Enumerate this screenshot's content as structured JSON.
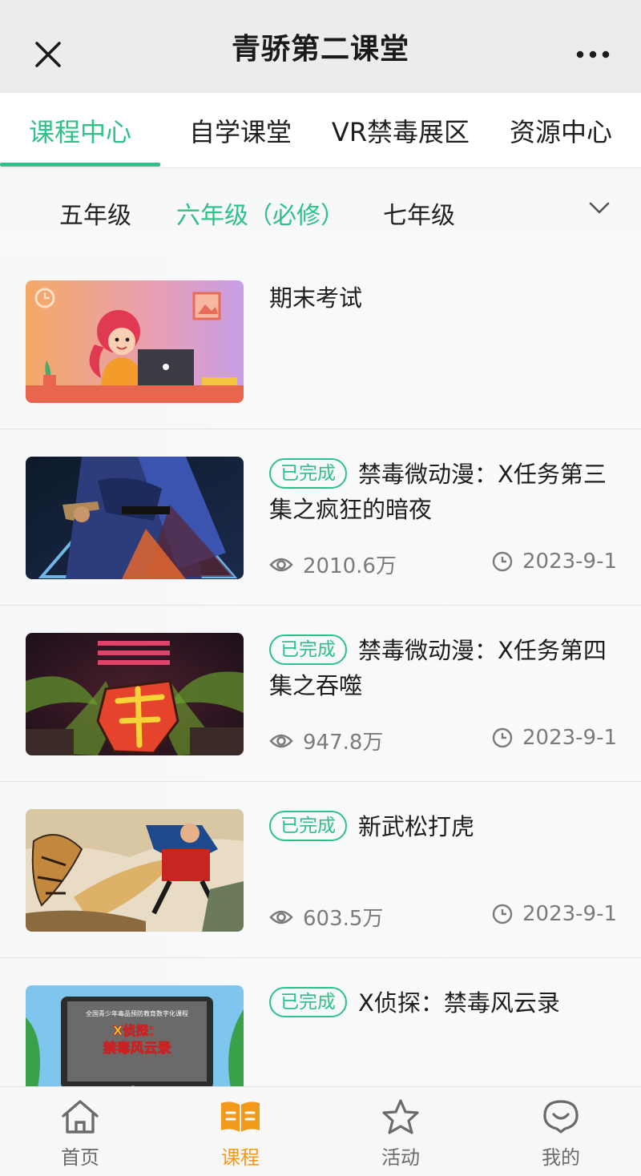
{
  "nav": {
    "title": "青骄第二课堂"
  },
  "tabs": [
    {
      "label": "课程中心",
      "active": true
    },
    {
      "label": "自学课堂",
      "active": false
    },
    {
      "label": "VR禁毒展区",
      "active": false
    },
    {
      "label": "资源中心",
      "active": false
    }
  ],
  "grades": [
    {
      "label": "五年级",
      "active": false
    },
    {
      "label": "六年级（必修）",
      "active": true
    },
    {
      "label": "七年级",
      "active": false
    }
  ],
  "courses": [
    {
      "badge": "",
      "title": "期末考试",
      "views": "",
      "date": ""
    },
    {
      "badge": "已完成",
      "title": "禁毒微动漫：X任务第三集之疯狂的暗夜",
      "views": "2010.6万",
      "date": "2023-9-1"
    },
    {
      "badge": "已完成",
      "title": "禁毒微动漫：X任务第四集之吞噬",
      "views": "947.8万",
      "date": "2023-9-1"
    },
    {
      "badge": "已完成",
      "title": "新武松打虎",
      "views": "603.5万",
      "date": "2023-9-1"
    },
    {
      "badge": "已完成",
      "title": "X侦探：禁毒风云录",
      "views": "",
      "date": ""
    }
  ],
  "thumb_texts": {
    "course4_line1": "全国青少年毒品预防教育数字化课程",
    "course4_line2": "X侦探：",
    "course4_line3": "禁毒风云录"
  },
  "bottom_nav": [
    {
      "label": "首页",
      "icon": "home-icon",
      "active": false
    },
    {
      "label": "课程",
      "icon": "book-icon",
      "active": true
    },
    {
      "label": "活动",
      "icon": "star-icon",
      "active": false
    },
    {
      "label": "我的",
      "icon": "smile-icon",
      "active": false
    }
  ],
  "colors": {
    "accent": "#2fc187",
    "active_tab_orange": "#f39a1d"
  }
}
